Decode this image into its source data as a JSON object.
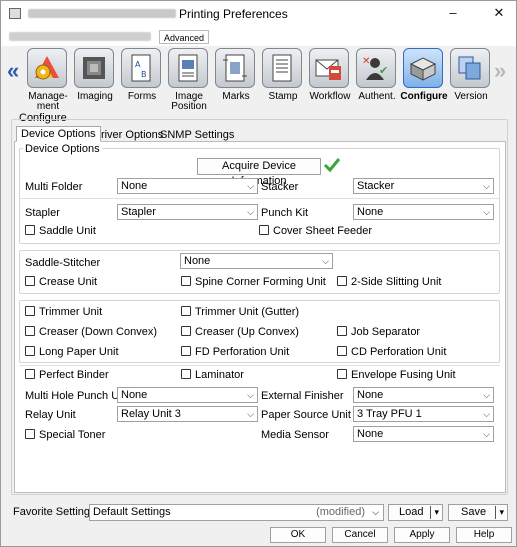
{
  "window": {
    "title": "Printing Preferences",
    "minimize": "–",
    "maximize": "☐",
    "close": "✕"
  },
  "subbar": {
    "advanced_tab": "Advanced"
  },
  "toolbar": {
    "items": [
      {
        "label": "Manage-\nment",
        "icon": "management-icon"
      },
      {
        "label": "Imaging",
        "icon": "imaging-icon"
      },
      {
        "label": "Forms",
        "icon": "forms-icon"
      },
      {
        "label": "Image\nPosition",
        "icon": "image-position-icon"
      },
      {
        "label": "Marks",
        "icon": "marks-icon"
      },
      {
        "label": "Stamp",
        "icon": "stamp-icon"
      },
      {
        "label": "Workflow",
        "icon": "workflow-icon"
      },
      {
        "label": "Authent.",
        "icon": "authentication-icon"
      },
      {
        "label": "Configure",
        "icon": "configure-icon",
        "selected": true
      },
      {
        "label": "Version",
        "icon": "version-icon"
      }
    ]
  },
  "configure": {
    "section_label": "Configure",
    "tabs": [
      "Device Options",
      "Driver Options",
      "SNMP Settings"
    ],
    "group_label": "Device Options",
    "acquire_button": "Acquire Device Information",
    "multi_folder": {
      "label": "Multi Folder",
      "value": "None"
    },
    "stacker": {
      "label": "Stacker",
      "value": "Stacker"
    },
    "stapler": {
      "label": "Stapler",
      "value": "Stapler"
    },
    "punch_kit": {
      "label": "Punch Kit",
      "value": "None"
    },
    "saddle_unit": "Saddle Unit",
    "cover_sheet_feeder": "Cover Sheet Feeder",
    "saddle_stitcher": {
      "label": "Saddle-Stitcher",
      "value": "None"
    },
    "crease_unit": "Crease Unit",
    "spine_corner": "Spine Corner Forming Unit",
    "two_side_slitting": "2-Side Slitting Unit",
    "trimmer_unit": "Trimmer Unit",
    "trimmer_unit_gutter": "Trimmer Unit (Gutter)",
    "creaser_down": "Creaser (Down Convex)",
    "creaser_up": "Creaser (Up Convex)",
    "job_separator": "Job Separator",
    "long_paper_unit": "Long Paper Unit",
    "fd_perforation": "FD Perforation Unit",
    "cd_perforation": "CD Perforation Unit",
    "perfect_binder": "Perfect Binder",
    "laminator": "Laminator",
    "envelope_fusing": "Envelope Fusing Unit",
    "multi_hole_punch": {
      "label": "Multi Hole Punch Unit",
      "value": "None"
    },
    "external_finisher": {
      "label": "External Finisher",
      "value": "None"
    },
    "relay_unit": {
      "label": "Relay Unit",
      "value": "Relay Unit 3"
    },
    "paper_source_unit": {
      "label": "Paper Source Unit",
      "value": "3 Tray PFU 1"
    },
    "special_toner": "Special Toner",
    "media_sensor": {
      "label": "Media Sensor",
      "value": "None"
    }
  },
  "footer": {
    "favorite_label": "Favorite Setting",
    "favorite_value": "Default Settings",
    "favorite_state": "(modified)",
    "load": "Load",
    "save": "Save",
    "ok": "OK",
    "cancel": "Cancel",
    "apply": "Apply",
    "help": "Help"
  },
  "colors": {
    "accent": "#2a6ec6",
    "check": "#3aa33a",
    "nav_arrow": "#2c5fb0"
  }
}
